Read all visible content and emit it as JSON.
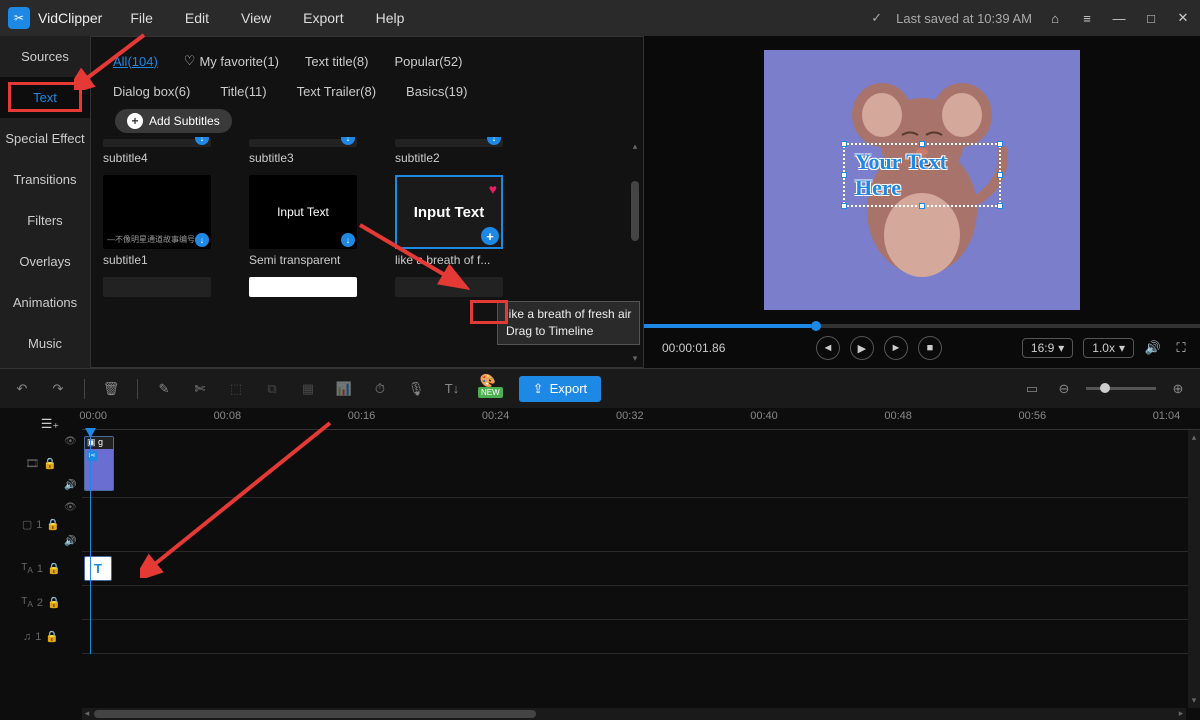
{
  "app": {
    "name": "VidClipper",
    "last_saved": "Last saved at 10:39 AM"
  },
  "menu": [
    "File",
    "Edit",
    "View",
    "Export",
    "Help"
  ],
  "sidebar": {
    "items": [
      "Sources",
      "Text",
      "Special Effect",
      "Transitions",
      "Filters",
      "Overlays",
      "Animations",
      "Music"
    ],
    "active": "Text"
  },
  "tabs": {
    "row1": [
      {
        "label": "All(104)",
        "active": true
      },
      {
        "label": "My favorite(1)"
      },
      {
        "label": "Text title(8)"
      },
      {
        "label": "Popular(52)"
      }
    ],
    "row2": [
      {
        "label": "Dialog box(6)"
      },
      {
        "label": "Title(11)"
      },
      {
        "label": "Text Trailer(8)"
      },
      {
        "label": "Basics(19)"
      }
    ]
  },
  "add_subtitles": "Add Subtitles",
  "grid": {
    "row1": [
      "subtitle4",
      "subtitle3",
      "subtitle2"
    ],
    "row2": [
      "subtitle1",
      "Semi transparent",
      "like a breath of f..."
    ],
    "selected_thumb_text": "Input Text",
    "semi_label": "Input Text"
  },
  "tooltip": {
    "line1": "like a breath of fresh air",
    "line2": "Drag to Timeline"
  },
  "preview": {
    "text_overlay": "Your Text Here",
    "timecode": "00:00:01.86",
    "aspect": "16:9",
    "speed": "1.0x"
  },
  "toolbar": {
    "export": "Export",
    "new": "NEW"
  },
  "timeline": {
    "ticks": [
      "00:00",
      "00:08",
      "00:16",
      "00:24",
      "00:32",
      "00:40",
      "00:48",
      "00:56",
      "01:04"
    ],
    "clip_label": "g",
    "text_clip": "T",
    "tracks": [
      {
        "icon": "film",
        "num": ""
      },
      {
        "icon": "layer",
        "num": "1"
      },
      {
        "icon": "TA",
        "num": "1"
      },
      {
        "icon": "TA",
        "num": "2"
      },
      {
        "icon": "music",
        "num": "1"
      }
    ]
  }
}
